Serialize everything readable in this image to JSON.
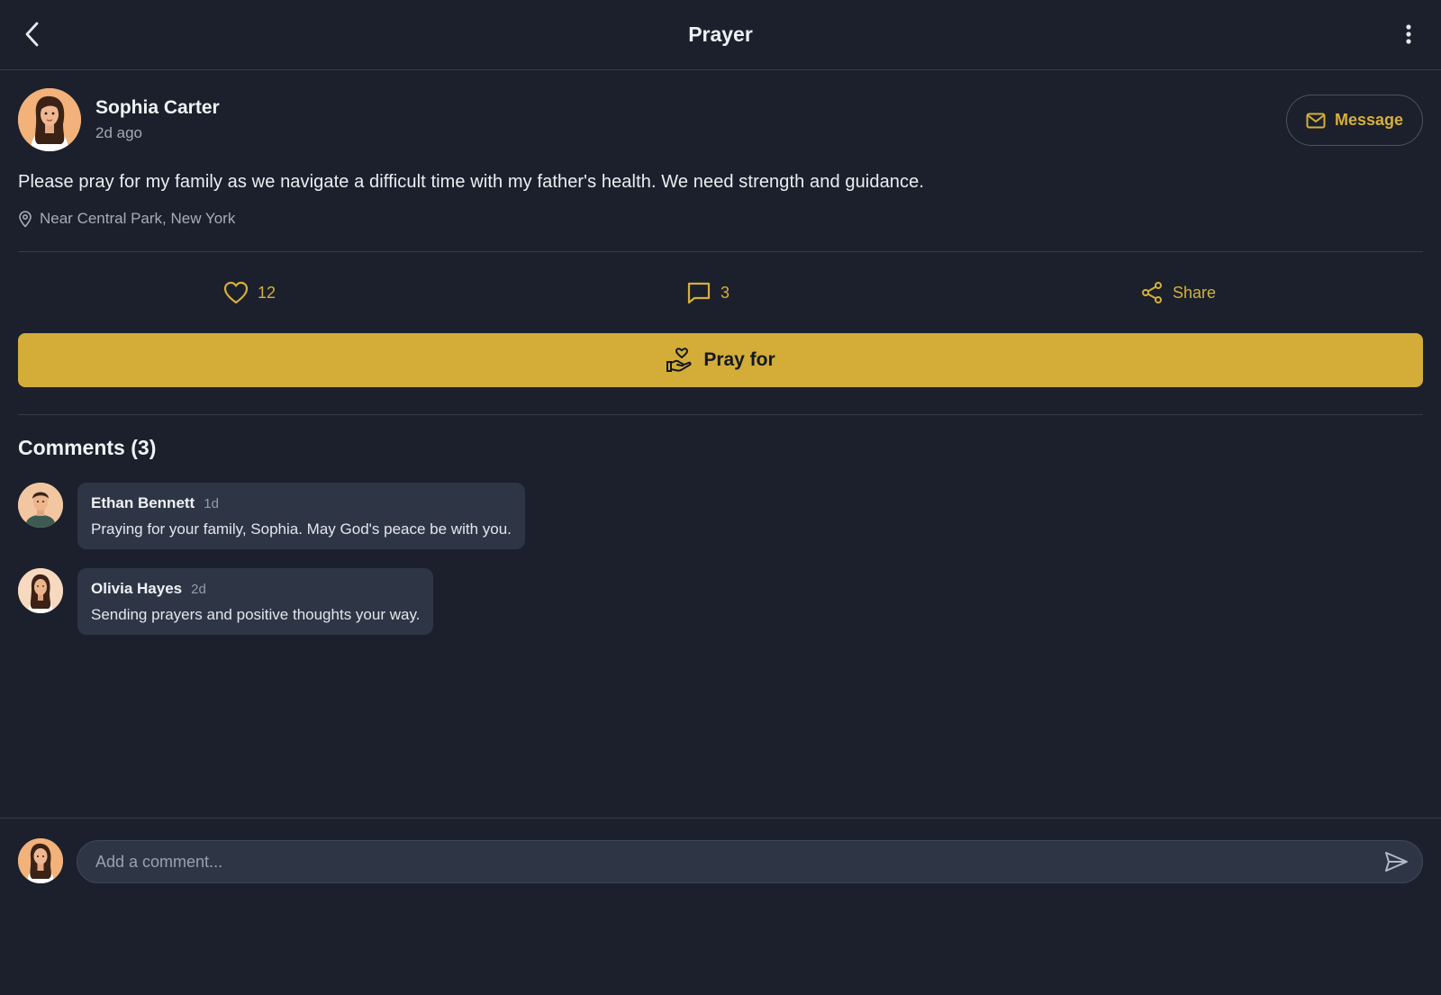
{
  "header": {
    "title": "Prayer",
    "back_icon": "chevron-left-icon",
    "more_icon": "more-vertical-icon"
  },
  "post": {
    "author": "Sophia Carter",
    "time": "2d ago",
    "message_button": "Message",
    "text": "Please pray for my family as we navigate a difficult time with my father's health. We need strength and guidance.",
    "location": "Near Central Park, New York",
    "likes": "12",
    "comments_count": "3",
    "share_label": "Share",
    "pray_button": "Pray for"
  },
  "comments": {
    "title": "Comments (3)",
    "items": [
      {
        "name": "Ethan Bennett",
        "time": "1d",
        "text": "Praying for your family, Sophia. May God's peace be with you."
      },
      {
        "name": "Olivia Hayes",
        "time": "2d",
        "text": "Sending prayers and positive thoughts your way."
      }
    ]
  },
  "composer": {
    "placeholder": "Add a comment...",
    "value": ""
  },
  "colors": {
    "background": "#1b202c",
    "accent": "#d3ad38",
    "bubble": "#2e3646",
    "divider": "#343b4a"
  }
}
